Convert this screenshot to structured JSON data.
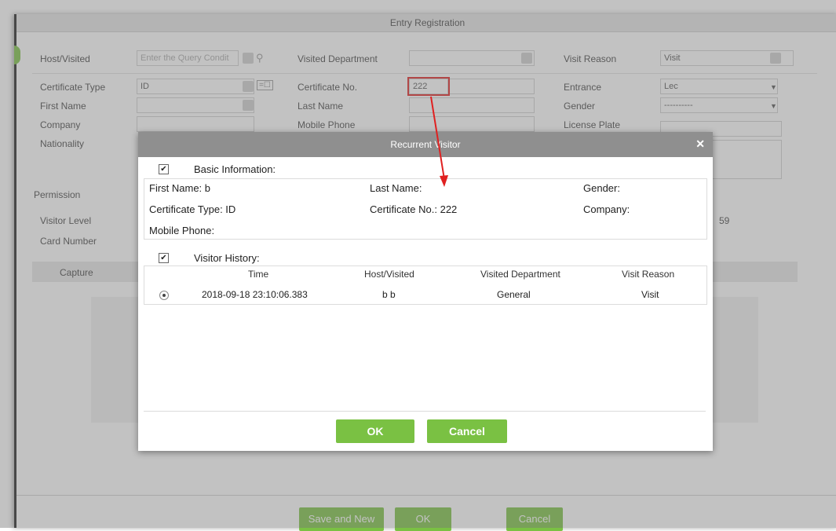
{
  "window": {
    "title": "Entry Registration"
  },
  "form": {
    "host_label": "Host/Visited",
    "host_placeholder": "Enter the Query Condit",
    "dept_label": "Visited Department",
    "reason_label": "Visit Reason",
    "reason_value": "Visit",
    "cert_type_label": "Certificate Type",
    "cert_type_value": "ID",
    "cert_no_label": "Certificate No.",
    "cert_no_value": "222",
    "entrance_label": "Entrance",
    "entrance_value": "Lec",
    "first_name_label": "First Name",
    "last_name_label": "Last Name",
    "gender_label": "Gender",
    "gender_value": "----------",
    "company_label": "Company",
    "mobile_label": "Mobile Phone",
    "license_label": "License Plate",
    "nationality_label": "Nationality",
    "permission_label": "Permission",
    "visitor_level_label": "Visitor Level",
    "card_number_label": "Card Number",
    "capture_tab": "Capture",
    "time_fragment": "59"
  },
  "footer": {
    "save_new": "Save and New",
    "ok": "OK",
    "cancel": "Cancel"
  },
  "modal": {
    "title": "Recurrent Visitor",
    "basic_info_label": "Basic Information:",
    "first_name": "First Name: b",
    "last_name": "Last Name:",
    "gender": "Gender:",
    "cert_type": "Certificate Type: ID",
    "cert_no": "Certificate No.: 222",
    "company": "Company:",
    "mobile": "Mobile Phone:",
    "history_label": "Visitor History:",
    "columns": [
      "Time",
      "Host/Visited",
      "Visited Department",
      "Visit Reason"
    ],
    "rows": [
      {
        "time": "2018-09-18 23:10:06.383",
        "host": "b b",
        "dept": "General",
        "reason": "Visit"
      }
    ],
    "ok_label": "OK",
    "cancel_label": "Cancel"
  },
  "colors": {
    "accent": "#7ac143",
    "highlight": "#e02020",
    "modal_header": "#8f8f8f"
  }
}
